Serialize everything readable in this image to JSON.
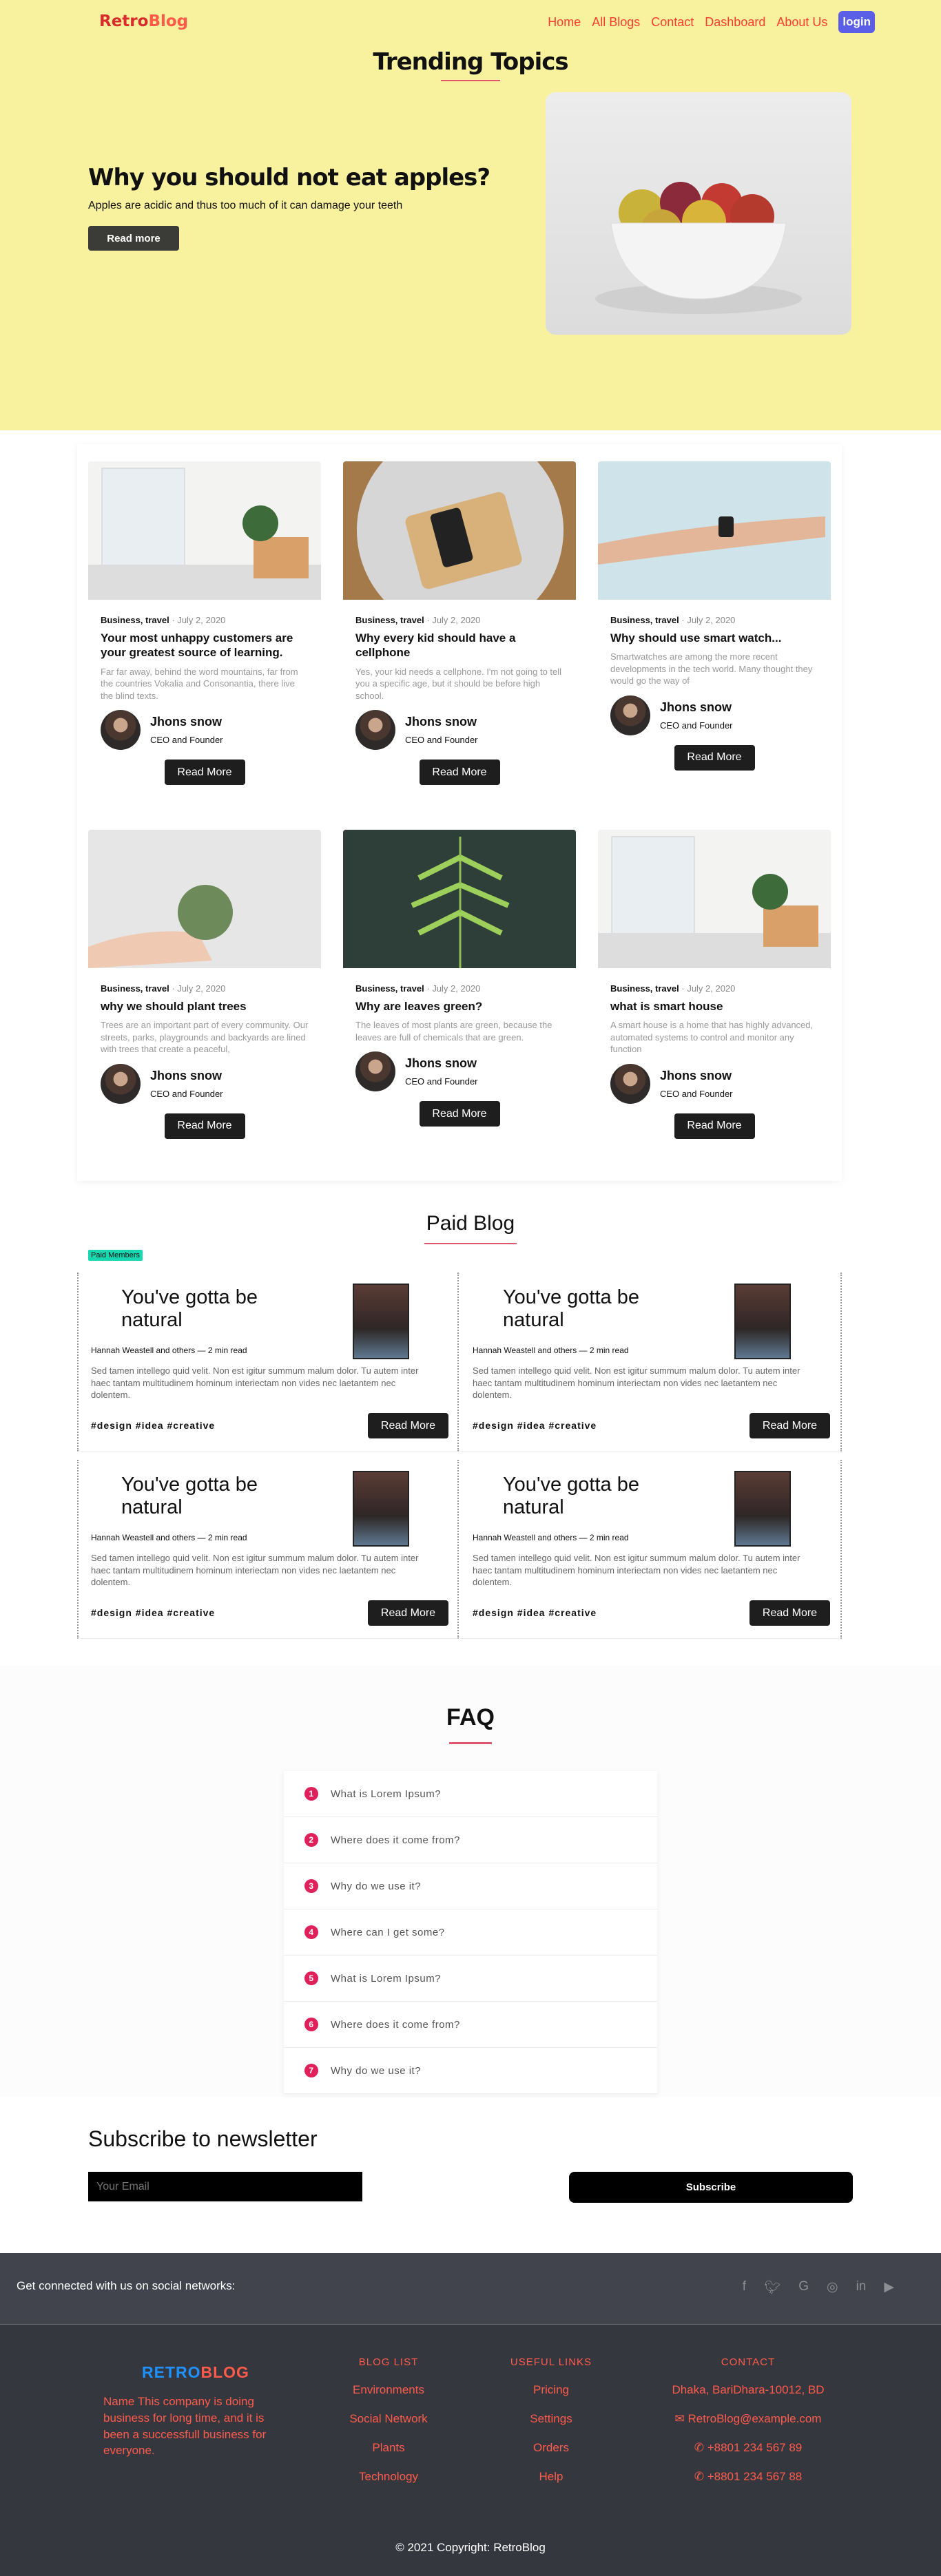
{
  "nav": {
    "logo_a": "Retro",
    "logo_b": "Blog",
    "links": [
      "Home",
      "All Blogs",
      "Contact",
      "Dashboard",
      "About Us"
    ],
    "login": "login"
  },
  "hero": {
    "section_title": "Trending Topics",
    "title": "Why you should not eat apples?",
    "subtitle": "Apples are acidic and thus too much of it can damage your teeth",
    "button": "Read more",
    "image_icon": "fruit-bowl-photo"
  },
  "cards": [
    {
      "category": "Business, travel",
      "date": "July 2, 2020",
      "title": "Your most unhappy customers are your greatest source of learning.",
      "desc": "Far far away, behind the word mountains, far from the countries Vokalia and Consonantia, there live the blind texts.",
      "author": "Jhons snow",
      "role": "CEO and Founder",
      "button": "Read More",
      "image": "kitchen-photo"
    },
    {
      "category": "Business, travel",
      "date": "July 2, 2020",
      "title": "Why every kid should have a cellphone",
      "desc": "Yes, your kid needs a cellphone. I'm not going to tell you a specific age, but it should be before high school.",
      "author": "Jhons snow",
      "role": "CEO and Founder",
      "button": "Read More",
      "image": "phone-tray-photo"
    },
    {
      "category": "Business, travel",
      "date": "July 2, 2020",
      "title": "Why should use smart watch...",
      "desc": "Smartwatches are among the more recent developments in the tech world. Many thought they would go the way of",
      "author": "Jhons snow",
      "role": "CEO and Founder",
      "button": "Read More",
      "image": "smartwatch-photo"
    },
    {
      "category": "Business, travel",
      "date": "July 2, 2020",
      "title": "why we should plant trees",
      "desc": "Trees are an important part of every community. Our streets, parks, playgrounds and backyards are lined with trees that create a peaceful,",
      "author": "Jhons snow",
      "role": "CEO and Founder",
      "button": "Read More",
      "image": "succulent-photo"
    },
    {
      "category": "Business, travel",
      "date": "July 2, 2020",
      "title": "Why are leaves green?",
      "desc": "The leaves of most plants are green, because the leaves are full of chemicals that are green.",
      "author": "Jhons snow",
      "role": "CEO and Founder",
      "button": "Read More",
      "image": "fern-photo"
    },
    {
      "category": "Business, travel",
      "date": "July 2, 2020",
      "title": "what is smart house",
      "desc": "A smart house is a home that has highly advanced, automated systems to control and monitor any function",
      "author": "Jhons snow",
      "role": "CEO and Founder",
      "button": "Read More",
      "image": "kitchen-photo"
    }
  ],
  "paid": {
    "title": "Paid Blog",
    "badge": "Paid Members",
    "items": [
      {
        "title": "You've gotta be natural",
        "byline": "Hannah Weastell and others — 2 min read",
        "text": "Sed tamen intellego quid velit. Non est igitur summum malum dolor. Tu autem inter haec tantam multitudinem hominum interiectam non vides nec laetantem nec dolentem.",
        "tags": "#design #idea #creative",
        "button": "Read More"
      },
      {
        "title": "You've gotta be natural",
        "byline": "Hannah Weastell and others — 2 min read",
        "text": "Sed tamen intellego quid velit. Non est igitur summum malum dolor. Tu autem inter haec tantam multitudinem hominum interiectam non vides nec laetantem nec dolentem.",
        "tags": "#design #idea #creative",
        "button": "Read More"
      },
      {
        "title": "You've gotta be natural",
        "byline": "Hannah Weastell and others — 2 min read",
        "text": "Sed tamen intellego quid velit. Non est igitur summum malum dolor. Tu autem inter haec tantam multitudinem hominum interiectam non vides nec laetantem nec dolentem.",
        "tags": "#design #idea #creative",
        "button": "Read More"
      },
      {
        "title": "You've gotta be natural",
        "byline": "Hannah Weastell and others — 2 min read",
        "text": "Sed tamen intellego quid velit. Non est igitur summum malum dolor. Tu autem inter haec tantam multitudinem hominum interiectam non vides nec laetantem nec dolentem.",
        "tags": "#design #idea #creative",
        "button": "Read More"
      }
    ]
  },
  "faq": {
    "title": "FAQ",
    "items": [
      {
        "num": "1",
        "q": "What is Lorem Ipsum?"
      },
      {
        "num": "2",
        "q": "Where does it come from?"
      },
      {
        "num": "3",
        "q": "Why do we use it?"
      },
      {
        "num": "4",
        "q": "Where can I get some?"
      },
      {
        "num": "5",
        "q": "What is Lorem Ipsum?"
      },
      {
        "num": "6",
        "q": "Where does it come from?"
      },
      {
        "num": "7",
        "q": "Why do we use it?"
      }
    ]
  },
  "newsletter": {
    "title": "Subscribe to newsletter",
    "placeholder": "Your Email",
    "button": "Subscribe"
  },
  "footer": {
    "social_text": "Get connected with us on social networks:",
    "social_icons": [
      "facebook-icon",
      "twitter-icon",
      "google-icon",
      "instagram-icon",
      "linkedin-icon",
      "youtube-icon"
    ],
    "logo_a": "RETRO",
    "logo_b": "BLOG",
    "desc": "Name This company is doing business for long time, and it is been a successfull business for everyone.",
    "blog_list": {
      "title": "BLOG LIST",
      "items": [
        "Environments",
        "Social Network",
        "Plants",
        "Technology"
      ]
    },
    "useful": {
      "title": "USEFUL LINKS",
      "items": [
        "Pricing",
        "Settings",
        "Orders",
        "Help"
      ]
    },
    "contact": {
      "title": "CONTACT",
      "address": "Dhaka, BariDhara-10012, BD",
      "email": "RetroBlog@example.com",
      "phone1": "+8801 234 567 89",
      "phone2": "+8801 234 567 88"
    },
    "copyright": "© 2021 Copyright: RetroBlog"
  },
  "colors": {
    "hero_bg": "#f8f29e",
    "accent": "#ff5a4a",
    "footer_bg": "#35373f",
    "badge": "#18d8b2"
  }
}
